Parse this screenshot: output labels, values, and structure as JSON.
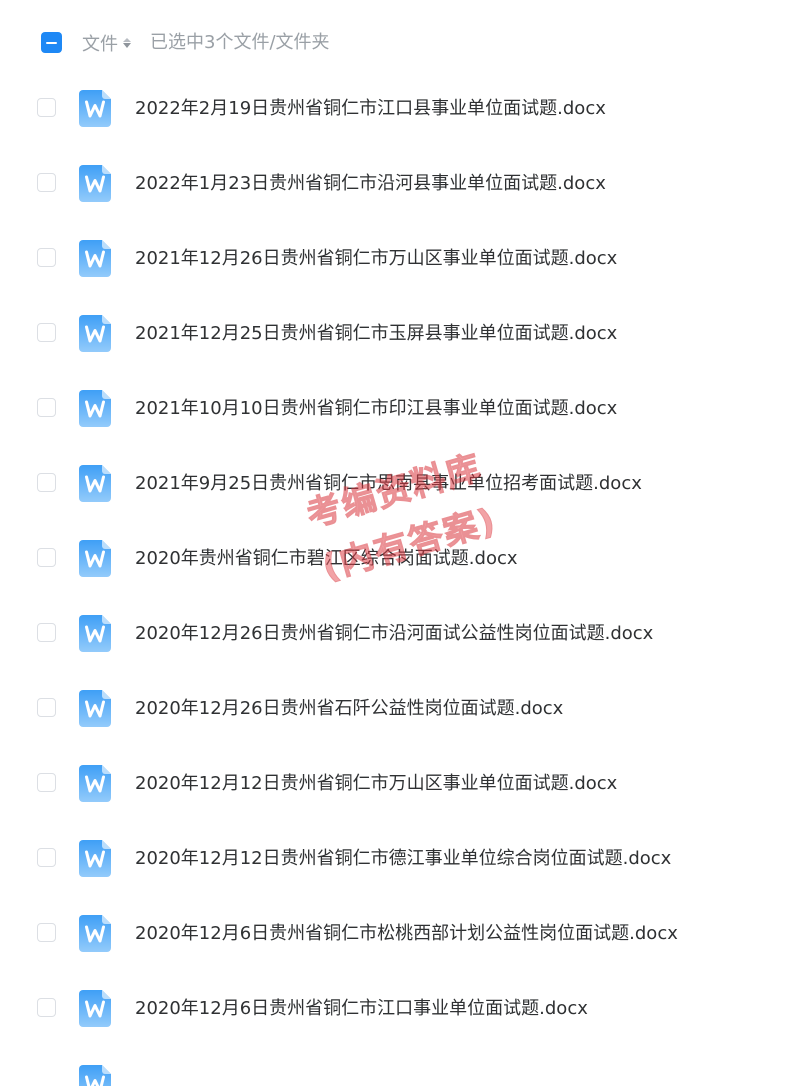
{
  "header": {
    "select_all_state": "partial",
    "file_column_label": "文件",
    "selected_info": "已选中3个文件/文件夹"
  },
  "colors": {
    "accent": "#1e88f5",
    "doc_icon_top": "#43a4f7",
    "doc_icon_bottom": "#8fc9fb",
    "text": "#2f3133",
    "muted": "#9aa0a6",
    "watermark": "#e8595f"
  },
  "files": [
    {
      "name": "2022年2月19日贵州省铜仁市江口县事业单位面试题.docx",
      "icon": "word-doc-icon",
      "checked": false
    },
    {
      "name": "2022年1月23日贵州省铜仁市沿河县事业单位面试题.docx",
      "icon": "word-doc-icon",
      "checked": false
    },
    {
      "name": "2021年12月26日贵州省铜仁市万山区事业单位面试题.docx",
      "icon": "word-doc-icon",
      "checked": false
    },
    {
      "name": "2021年12月25日贵州省铜仁市玉屏县事业单位面试题.docx",
      "icon": "word-doc-icon",
      "checked": false
    },
    {
      "name": "2021年10月10日贵州省铜仁市印江县事业单位面试题.docx",
      "icon": "word-doc-icon",
      "checked": false
    },
    {
      "name": "2021年9月25日贵州省铜仁市思南县事业单位招考面试题.docx",
      "icon": "word-doc-icon",
      "checked": false
    },
    {
      "name": "2020年贵州省铜仁市碧江区综合岗面试题.docx",
      "icon": "word-doc-icon",
      "checked": false
    },
    {
      "name": "2020年12月26日贵州省铜仁市沿河面试公益性岗位面试题.docx",
      "icon": "word-doc-icon",
      "checked": false
    },
    {
      "name": "2020年12月26日贵州省石阡公益性岗位面试题.docx",
      "icon": "word-doc-icon",
      "checked": false
    },
    {
      "name": "2020年12月12日贵州省铜仁市万山区事业单位面试题.docx",
      "icon": "word-doc-icon",
      "checked": false
    },
    {
      "name": "2020年12月12日贵州省铜仁市德江事业单位综合岗位面试题.docx",
      "icon": "word-doc-icon",
      "checked": false
    },
    {
      "name": "2020年12月6日贵州省铜仁市松桃西部计划公益性岗位面试题.docx",
      "icon": "word-doc-icon",
      "checked": false
    },
    {
      "name": "2020年12月6日贵州省铜仁市江口事业单位面试题.docx",
      "icon": "word-doc-icon",
      "checked": false
    }
  ],
  "watermark": {
    "line1": "考编资料库",
    "line2": "(内有答案)"
  }
}
